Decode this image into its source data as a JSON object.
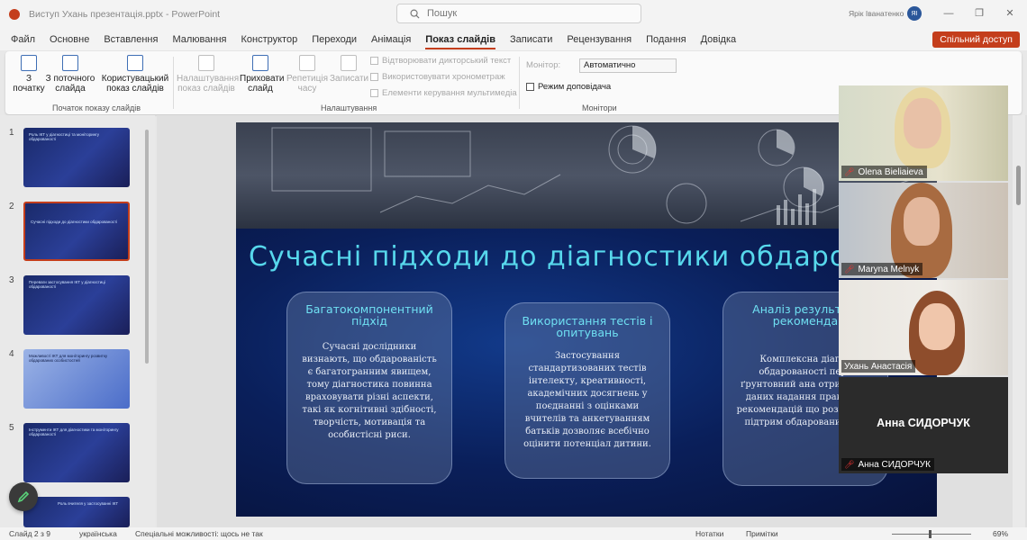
{
  "app": {
    "title": "Виступ Ухань презентація.pptx - PowerPoint",
    "search_placeholder": "Пошук",
    "user_name": "Ярік Іванатенко",
    "user_initials": "ЯІ",
    "accent": "#c43e1c"
  },
  "tabs": [
    "Файл",
    "Основне",
    "Вставлення",
    "Малювання",
    "Конструктор",
    "Переходи",
    "Анімація",
    "Показ слайдів",
    "Записати",
    "Рецензування",
    "Подання",
    "Довідка"
  ],
  "active_tab": "Показ слайдів",
  "share_label": "Спільний доступ",
  "ribbon": {
    "groups": {
      "start": "Початок показу слайдів",
      "setup": "Налаштування",
      "monitors": "Монітори"
    },
    "buttons": {
      "from_beginning": "З початку",
      "from_current": "З поточного слайда",
      "custom": "Користувацький показ слайдів",
      "setup_show": "Налаштування показ слайдів",
      "hide_slide": "Приховати слайд",
      "rehearse": "Репетиція часу",
      "record": "Записати"
    },
    "checkboxes": {
      "play_narrations": "Відтворювати дикторський текст",
      "use_timings": "Використовувати хронометраж",
      "show_media_controls": "Елементи керування мультимедіа",
      "presenter_view": "Режим доповідача"
    },
    "monitor_label": "Монітор:",
    "monitor_value": "Автоматично"
  },
  "thumbnails": [
    {
      "num": "1",
      "title": "Роль ІКТ у діагностиці та моніторингу обдарованості"
    },
    {
      "num": "2",
      "title": "Сучасні підходи до діагностики обдарованості"
    },
    {
      "num": "3",
      "title": "Переваги застосування ІКТ у діагностиці обдарованості"
    },
    {
      "num": "4",
      "title": "Можливості ІКТ для моніторингу розвитку обдарованих особистостей"
    },
    {
      "num": "5",
      "title": "Інструменти ІКТ для діагностики та моніторингу обдарованості"
    },
    {
      "num": "",
      "title": "Роль вчителя у застосуванні ІКТ"
    }
  ],
  "slide": {
    "title": "Сучасні підходи до діагностики обдаров",
    "cards": [
      {
        "heading": "Багатокомпонентний підхід",
        "text": "Сучасні дослідники визнають, що обдарованість є багатогранним явищем, тому діагностика повинна враховувати різні аспекти, такі як когнітивні здібності, творчість, мотивація та особистісні риси."
      },
      {
        "heading": "Використання тестів і опитувань",
        "text": "Застосування стандартизованих тестів інтелекту, креативності, академічних досягнень у поєднанні з оцінками вчителів та анкетуванням батьків дозволяє всебічно оцінити потенціал дитини."
      },
      {
        "heading": "Аналіз результ та рекоменда",
        "text": "Комплексна діагно обдарованості пере ґрунтовний ана отриманих даних надання практичн рекомендацій що розвитку й підтрим обдарованих учн"
      }
    ]
  },
  "participants": [
    {
      "name": "Olena Bieliaieva",
      "muted": true
    },
    {
      "name": "Maryna Melnyk",
      "muted": true
    },
    {
      "name": "Ухань Анастасія",
      "muted": false
    },
    {
      "name": "Анна СИДОРЧУК",
      "muted": true,
      "display_name": "Анна СИДОРЧУК"
    }
  ],
  "status": {
    "slide_of": "Слайд 2 з 9",
    "language": "українська",
    "accessibility": "Спеціальні можливості: щось не так",
    "notes": "Нотатки",
    "comments": "Примітки",
    "zoom": "69%"
  }
}
